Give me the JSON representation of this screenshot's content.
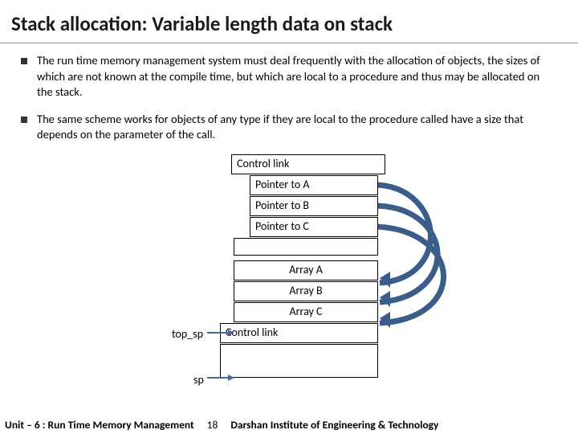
{
  "title": "Stack allocation: Variable length data on stack",
  "bullets": {
    "b1": "The run time memory management system must deal frequently with the allocation of objects, the sizes of which are not known at the compile time, but which are local to a procedure and thus may be allocated on the stack.",
    "b2": "The same scheme works for objects of any type if they are local to the procedure called have a size that depends on the parameter of the call."
  },
  "stack": {
    "control_link_1": "Control link",
    "ptr_a": "Pointer to A",
    "ptr_b": "Pointer to B",
    "ptr_c": "Pointer to C",
    "arr_a": "Array A",
    "arr_b": "Array B",
    "arr_c": "Array C",
    "control_link_2": "Control link"
  },
  "labels": {
    "top_sp": "top_sp",
    "sp": "sp"
  },
  "footer": {
    "left": "Unit – 6 : Run Time Memory Management",
    "page": "18",
    "right": "Darshan Institute of Engineering & Technology"
  }
}
